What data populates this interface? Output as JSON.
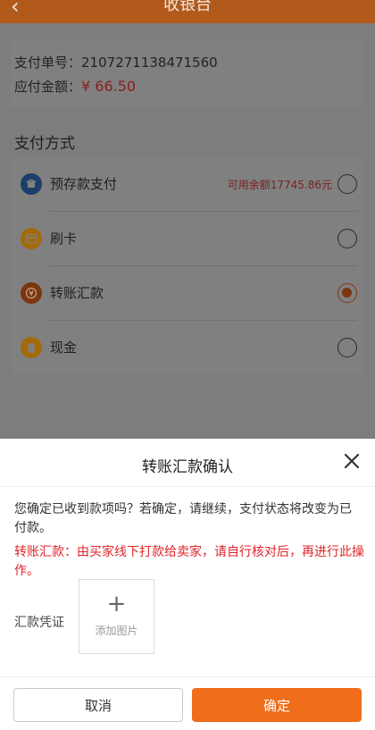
{
  "header": {
    "title": "收银台",
    "back_icon": "chevron-left-icon"
  },
  "order": {
    "no_label": "支付单号：",
    "no_value": "2107271138471560",
    "amount_label": "应付金额：",
    "amount_value": "¥ 66.50"
  },
  "payment": {
    "section_title": "支付方式",
    "methods": [
      {
        "label": "预存款支付",
        "balance": "可用余额17745.86元",
        "icon": "deposit-icon",
        "color": "#1b3e6b",
        "selected": false
      },
      {
        "label": "刷卡",
        "balance": "",
        "icon": "card-icon",
        "color": "#a36a0a",
        "selected": false
      },
      {
        "label": "转账汇款",
        "balance": "",
        "icon": "transfer-icon",
        "color": "#7b3510",
        "selected": true
      },
      {
        "label": "现金",
        "balance": "",
        "icon": "cash-icon",
        "color": "#a36a0a",
        "selected": false
      }
    ]
  },
  "dialog": {
    "title": "转账汇款确认",
    "close_icon": "close-icon",
    "confirm_text": "您确定已收到款项吗？若确定，请继续，支付状态将改变为已付款。",
    "warn_text": "转账汇款：由买家线下打款给卖家，请自行核对后，再进行此操作。",
    "voucher_label": "汇款凭证",
    "upload_plus": "+",
    "upload_text": "添加图片",
    "cancel_label": "取消",
    "ok_label": "确定"
  },
  "colors": {
    "accent": "#ef6d1b",
    "warning": "#e0242a"
  }
}
